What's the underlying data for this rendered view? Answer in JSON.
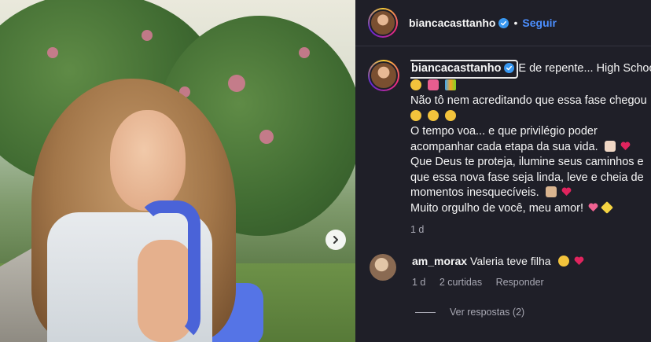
{
  "post": {
    "username": "biancacasttanho",
    "follow_label": "Seguir",
    "separator": "•",
    "caption": {
      "username": "biancacasttanho",
      "lines": [
        "E de repente... High School",
        "Não tô nem acreditando que essa fase chegou",
        "O tempo voa... e que privilégio poder",
        "acompanhar cada etapa da sua vida.",
        "Que Deus te proteja, ilumine seus caminhos e",
        "que essa nova fase seja linda, leve e cheia de",
        "momentos inesquecíveis.",
        "Muito orgulho de você, meu amor!"
      ],
      "time": "1 d"
    },
    "comment": {
      "username": "am_morax",
      "text": "Valeria teve filha",
      "time": "1 d",
      "likes": "2 curtidas",
      "reply_label": "Responder",
      "view_replies": "Ver respostas (2)"
    }
  },
  "icons": {
    "next": "chevron-right-icon",
    "verified": "verified-badge-icon",
    "heart": "heart-emoji"
  },
  "colors": {
    "panel_bg": "#1f1f28",
    "link_blue": "#4c8fff",
    "verified_blue": "#3897f0",
    "muted": "#a8a8b3",
    "heart": "#e0245e"
  }
}
